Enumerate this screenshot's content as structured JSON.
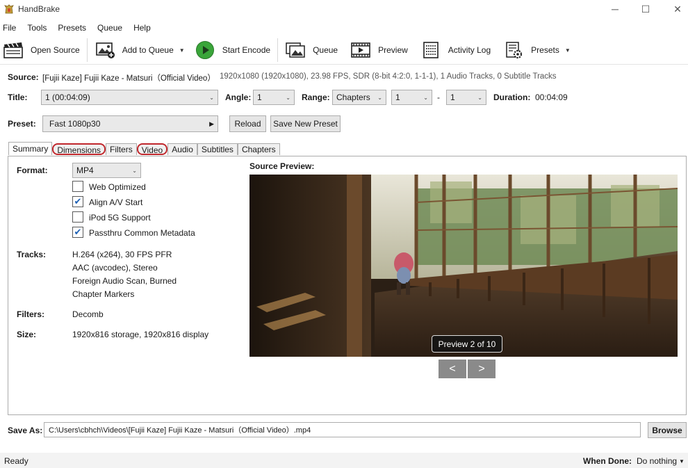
{
  "window": {
    "title": "HandBrake",
    "controls": {
      "minimize": "─",
      "maximize": "☐",
      "close": "✕"
    }
  },
  "menu": [
    "File",
    "Tools",
    "Presets",
    "Queue",
    "Help"
  ],
  "toolbar": {
    "open_source": "Open Source",
    "add_to_queue": "Add to Queue",
    "start_encode": "Start Encode",
    "queue": "Queue",
    "preview": "Preview",
    "activity_log": "Activity Log",
    "presets": "Presets"
  },
  "source": {
    "label": "Source:",
    "name": "[Fujii Kaze] Fujii Kaze - Matsuri（Official Video）",
    "info": "1920x1080 (1920x1080), 23.98 FPS, SDR (8-bit 4:2:0, 1-1-1), 1 Audio Tracks, 0 Subtitle Tracks"
  },
  "title_row": {
    "title_label": "Title:",
    "title_value": "1 (00:04:09)",
    "angle_label": "Angle:",
    "angle_value": "1",
    "range_label": "Range:",
    "range_type": "Chapters",
    "range_start": "1",
    "range_dash": "-",
    "range_end": "1",
    "duration_label": "Duration:",
    "duration_value": "00:04:09"
  },
  "preset_row": {
    "label": "Preset:",
    "value": "Fast 1080p30",
    "reload": "Reload",
    "save_new": "Save New Preset"
  },
  "tabs": [
    "Summary",
    "Dimensions",
    "Filters",
    "Video",
    "Audio",
    "Subtitles",
    "Chapters"
  ],
  "summary": {
    "format_label": "Format:",
    "format_value": "MP4",
    "options": [
      {
        "label": "Web Optimized",
        "checked": false
      },
      {
        "label": "Align A/V Start",
        "checked": true
      },
      {
        "label": "iPod 5G Support",
        "checked": false
      },
      {
        "label": "Passthru Common Metadata",
        "checked": true
      }
    ],
    "tracks_label": "Tracks:",
    "tracks": [
      "H.264 (x264), 30 FPS PFR",
      "AAC (avcodec), Stereo",
      "Foreign Audio Scan, Burned",
      "Chapter Markers"
    ],
    "filters_label": "Filters:",
    "filters_value": "Decomb",
    "size_label": "Size:",
    "size_value": "1920x816 storage, 1920x816 display",
    "preview_label": "Source Preview:",
    "preview_badge": "Preview 2 of 10",
    "prev": "<",
    "next": ">"
  },
  "save_as": {
    "label": "Save As:",
    "path": "C:\\Users\\cbhch\\Videos\\[Fujii Kaze] Fujii Kaze - Matsuri（Official Video）.mp4",
    "browse": "Browse"
  },
  "status": {
    "text": "Ready",
    "when_done_label": "When Done:",
    "when_done_value": "Do nothing"
  },
  "colors": {
    "annotation_circle": "#c0282d",
    "start_encode_green": "#3aa53a"
  }
}
